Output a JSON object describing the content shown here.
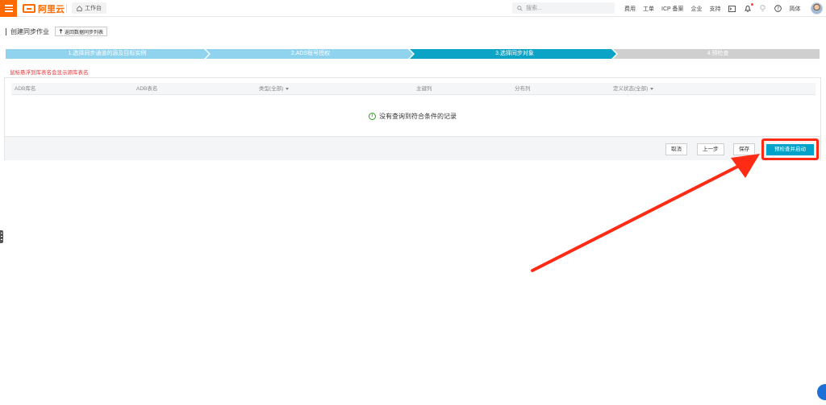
{
  "topbar": {
    "logo_text": "阿里云",
    "workbench_label": "工作台",
    "search_placeholder": "搜索...",
    "nav_items": [
      "费用",
      "工单",
      "ICP 备案",
      "企业",
      "支持"
    ],
    "lang_label": "简体"
  },
  "page": {
    "title": "创建同步作业",
    "back_button": "返回数据同步列表"
  },
  "steps": [
    {
      "label": "1.选择同步通道的源及目标实例",
      "state": "done"
    },
    {
      "label": "2.ADS账号授权",
      "state": "done"
    },
    {
      "label": "3.选择同步对象",
      "state": "active"
    },
    {
      "label": "4.预检查",
      "state": "pending"
    }
  ],
  "colors": {
    "brand": "#ff6a00",
    "step_done": "#8fd3ee",
    "step_active": "#0ba3c6",
    "step_pending": "#cfcfcf",
    "primary_button": "#00a2ca",
    "annotation": "#ff2b14"
  },
  "hint": "鼠标悬浮到库表名会显示源库表名",
  "table": {
    "columns": [
      {
        "label": "ADB库名",
        "sortable": false
      },
      {
        "label": "ADB表名",
        "sortable": false
      },
      {
        "label": "类型(全部)",
        "sortable": true
      },
      {
        "label": "主键列",
        "sortable": false
      },
      {
        "label": "分布列",
        "sortable": false
      },
      {
        "label": "定义状态(全部)",
        "sortable": true
      }
    ],
    "empty_text": "没有查询到符合条件的记录"
  },
  "footer": {
    "cancel": "取消",
    "prev": "上一步",
    "save": "保存",
    "primary": "预检查并启动"
  }
}
